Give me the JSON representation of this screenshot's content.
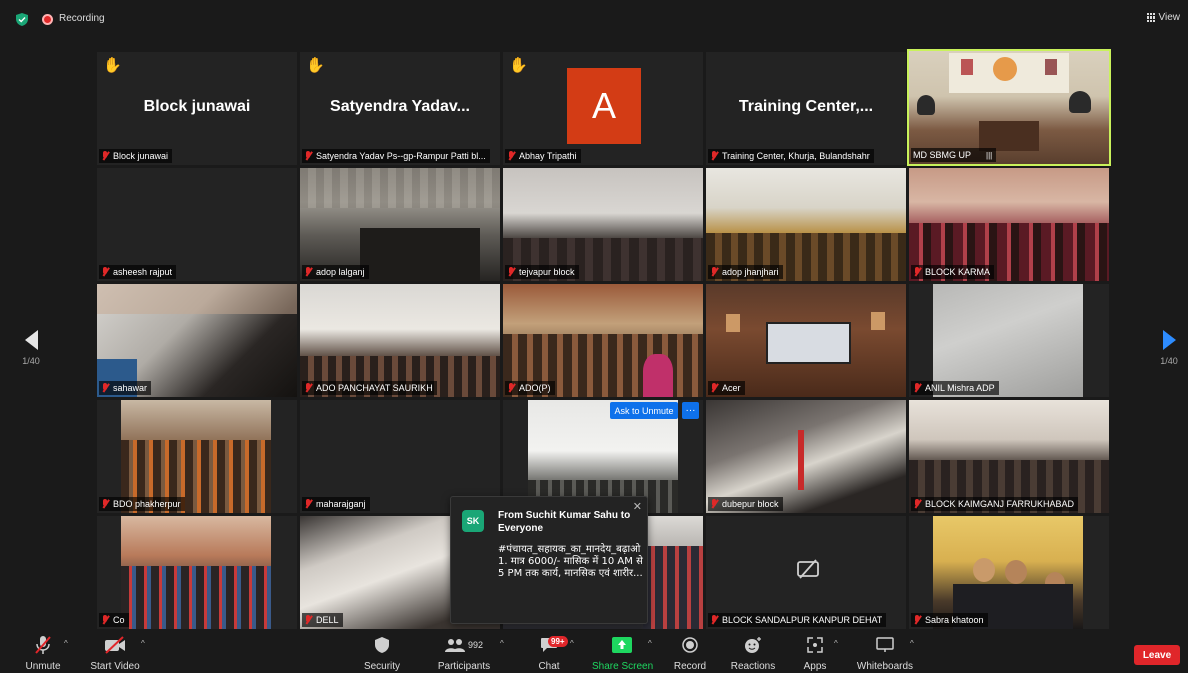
{
  "topbar": {
    "recording_label": "Recording",
    "view_label": "View"
  },
  "nav": {
    "left_page": "1/40",
    "right_page": "1/40"
  },
  "tiles": [
    {
      "name": "Block junawai",
      "display_name": "Block junawai",
      "hand_raised": true
    },
    {
      "name": "Satyendra Yadav Ps--gp-Rampur Patti bl...",
      "display_name": "Satyendra  Yadav...",
      "hand_raised": true
    },
    {
      "name": "Abhay Tripathi",
      "avatar_letter": "A",
      "hand_raised": true
    },
    {
      "name": "Training Center, Khurja, Bulandshahr",
      "display_name": "Training  Center,..."
    },
    {
      "name": "MD SBMG UP"
    },
    {
      "name": "asheesh rajput"
    },
    {
      "name": "adop lalganj"
    },
    {
      "name": "tejvapur block"
    },
    {
      "name": "adop jhanjhari"
    },
    {
      "name": "BLOCK KARMA"
    },
    {
      "name": "sahawar"
    },
    {
      "name": "ADO PANCHAYAT SAURIKH"
    },
    {
      "name": "ADO(P)"
    },
    {
      "name": "Acer"
    },
    {
      "name": "ANIL Mishra ADP"
    },
    {
      "name": "BDO phakherpur"
    },
    {
      "name": "maharajganj"
    },
    {
      "name": ""
    },
    {
      "name": "dubepur block"
    },
    {
      "name": "BLOCK KAIMGANJ FARRUKHABAD"
    },
    {
      "name": "Co"
    },
    {
      "name": "DELL"
    },
    {
      "name": ""
    },
    {
      "name": "BLOCK SANDALPUR KANPUR DEHAT"
    },
    {
      "name": "Sabra khatoon"
    }
  ],
  "overlay": {
    "ask_unmute": "Ask to Unmute",
    "more": "···"
  },
  "chat_popup": {
    "initials": "SK",
    "from": "From Suchit Kumar Sahu to Everyone",
    "message": "#पंचायत_सहायक_का_मानदेय_बढ़ाओ\n1. मात्र 6000/- मासिक में 10 AM से 5 PM तक कार्य, मानसिक एवं शारीर...",
    "close": "✕"
  },
  "toolbar": {
    "unmute": "Unmute",
    "start_video": "Start Video",
    "security": "Security",
    "participants": "Participants",
    "participants_count": "992",
    "chat": "Chat",
    "chat_badge": "99+",
    "share_screen": "Share Screen",
    "record": "Record",
    "reactions": "Reactions",
    "apps": "Apps",
    "whiteboards": "Whiteboards",
    "leave": "Leave"
  },
  "colors": {
    "accent_blue": "#0e71eb",
    "active_speaker": "#c9f25b",
    "share_green": "#1ed760",
    "leave_red": "#e0262a",
    "avatar_orange": "#d33c15"
  }
}
